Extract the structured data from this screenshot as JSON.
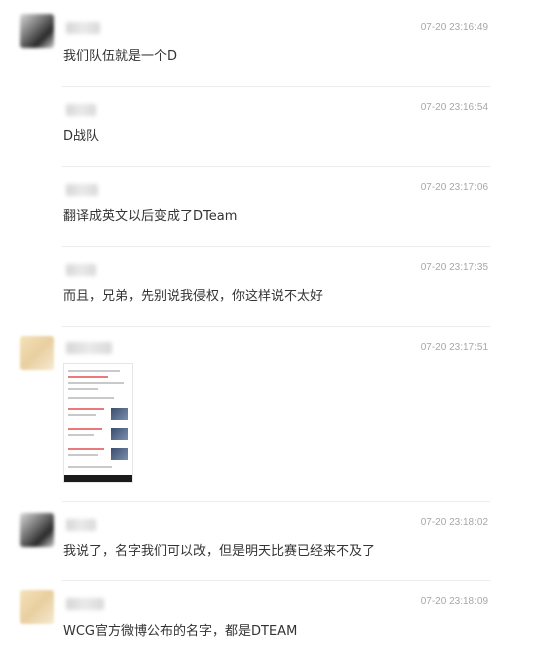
{
  "messages": [
    {
      "time": "07-20 23:16:49",
      "text": "我们队伍就是一个D",
      "avatar": "dark"
    },
    {
      "time": "07-20 23:16:54",
      "text": "D战队",
      "avatar": "none"
    },
    {
      "time": "07-20 23:17:06",
      "text": "翻译成英文以后变成了DTeam",
      "avatar": "none"
    },
    {
      "time": "07-20 23:17:35",
      "text": "而且，兄弟，先别说我侵权，你这样说不太好",
      "avatar": "none"
    },
    {
      "time": "07-20 23:17:51",
      "text": "",
      "avatar": "cream",
      "image": "screenshot-image"
    },
    {
      "time": "07-20 23:18:02",
      "text": "我说了，名字我们可以改，但是明天比赛已经来不及了",
      "avatar": "dark"
    },
    {
      "time": "07-20 23:18:09",
      "text": "WCG官方微博公布的名字，都是DTEAM",
      "avatar": "cream"
    }
  ],
  "colors": {
    "text": "#333333",
    "time": "#a7a7a7",
    "divider": "#ececec",
    "background": "#ffffff"
  }
}
